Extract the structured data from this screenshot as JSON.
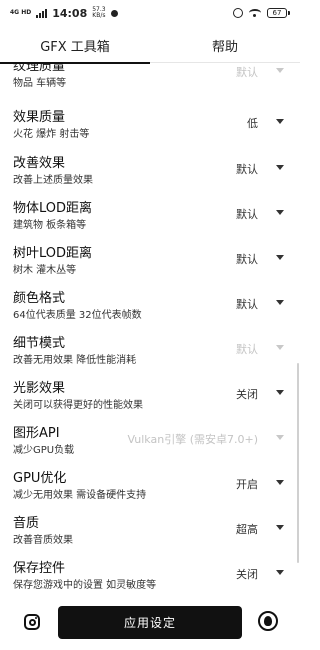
{
  "status_bar": {
    "signal": "4G HD",
    "time": "14:08",
    "net_speed_value": "57.3",
    "net_speed_unit": "KB/s",
    "battery": "67"
  },
  "tabs": [
    {
      "label": "GFX 工具箱",
      "active": true
    },
    {
      "label": "帮助",
      "active": false
    }
  ],
  "settings": [
    {
      "title": "纹理质量",
      "desc": "物品 车辆等",
      "value": "默认",
      "disabled": true
    },
    {
      "title": "效果质量",
      "desc": "火花 爆炸 射击等",
      "value": "低",
      "disabled": false
    },
    {
      "title": "改善效果",
      "desc": "改善上述质量效果",
      "value": "默认",
      "disabled": false
    },
    {
      "title": "物体LOD距离",
      "desc": "建筑物 板条箱等",
      "value": "默认",
      "disabled": false
    },
    {
      "title": "树叶LOD距离",
      "desc": "树木 灌木丛等",
      "value": "默认",
      "disabled": false
    },
    {
      "title": "颜色格式",
      "desc": "64位代表质量 32位代表帧数",
      "value": "默认",
      "disabled": false
    },
    {
      "title": "细节模式",
      "desc": "改善无用效果 降低性能消耗",
      "value": "默认",
      "disabled": true
    },
    {
      "title": "光影效果",
      "desc": "关闭可以获得更好的性能效果",
      "value": "关闭",
      "disabled": false
    },
    {
      "title": "图形API",
      "desc": "减少GPU负载",
      "value": "Vulkan引擎 (需安卓7.0+)",
      "disabled": true
    },
    {
      "title": "GPU优化",
      "desc": "减少无用效果 需设备硬件支持",
      "value": "开启",
      "disabled": false
    },
    {
      "title": "音质",
      "desc": "改善音质效果",
      "value": "超高",
      "disabled": false
    },
    {
      "title": "保存控件",
      "desc": "保存您游戏中的设置 如灵敏度等",
      "value": "关闭",
      "disabled": false
    }
  ],
  "bottom": {
    "apply_label": "应用设定"
  }
}
